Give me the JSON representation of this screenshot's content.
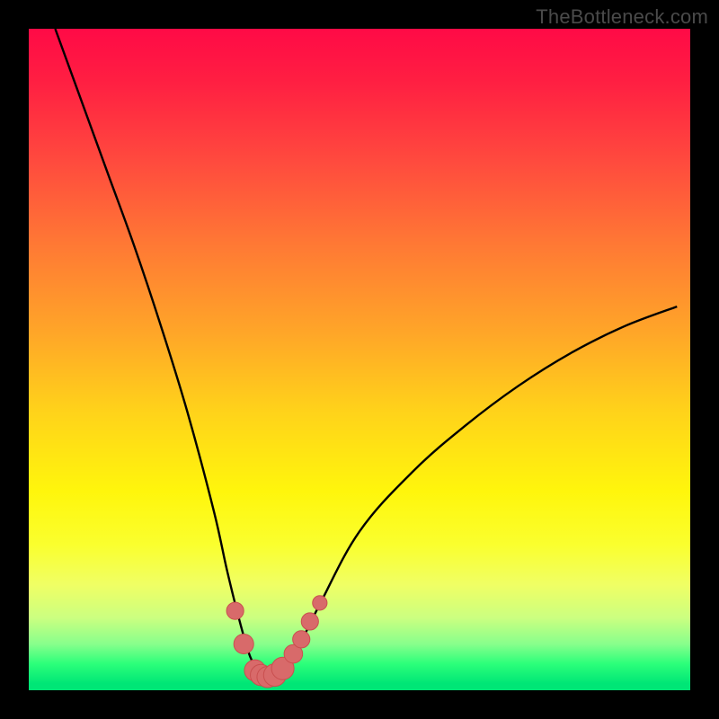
{
  "watermark": "TheBottleneck.com",
  "colors": {
    "frame": "#000000",
    "curve_stroke": "#000000",
    "marker_fill": "#d86a6a",
    "marker_stroke": "#c94f4f"
  },
  "chart_data": {
    "type": "line",
    "title": "",
    "xlabel": "",
    "ylabel": "",
    "xlim": [
      0,
      100
    ],
    "ylim": [
      0,
      100
    ],
    "grid": false,
    "series": [
      {
        "name": "bottleneck-curve",
        "x": [
          4,
          8,
          12,
          16,
          20,
          24,
          28,
          30,
          32,
          33.5,
          35,
          36.5,
          38,
          40,
          44,
          50,
          58,
          66,
          74,
          82,
          90,
          98
        ],
        "y": [
          100,
          89,
          78,
          67,
          55,
          42,
          27,
          18,
          10,
          5,
          2.5,
          2,
          2.5,
          5,
          13,
          24,
          33,
          40,
          46,
          51,
          55,
          58
        ]
      }
    ],
    "markers": [
      {
        "name": "marker-left-top",
        "x": 31.2,
        "y": 12.0,
        "r": 1.3
      },
      {
        "name": "marker-left-mid",
        "x": 32.5,
        "y": 7.0,
        "r": 1.5
      },
      {
        "name": "marker-bottom-1",
        "x": 34.2,
        "y": 3.0,
        "r": 1.6
      },
      {
        "name": "marker-bottom-2",
        "x": 35.1,
        "y": 2.3,
        "r": 1.6
      },
      {
        "name": "marker-bottom-3",
        "x": 36.1,
        "y": 2.0,
        "r": 1.6
      },
      {
        "name": "marker-bottom-4",
        "x": 37.2,
        "y": 2.3,
        "r": 1.7
      },
      {
        "name": "marker-bottom-5",
        "x": 38.4,
        "y": 3.3,
        "r": 1.7
      },
      {
        "name": "marker-right-1",
        "x": 40.0,
        "y": 5.5,
        "r": 1.4
      },
      {
        "name": "marker-right-2",
        "x": 41.2,
        "y": 7.7,
        "r": 1.3
      },
      {
        "name": "marker-right-3",
        "x": 42.5,
        "y": 10.4,
        "r": 1.3
      },
      {
        "name": "marker-right-top",
        "x": 44.0,
        "y": 13.2,
        "r": 1.1
      }
    ]
  }
}
